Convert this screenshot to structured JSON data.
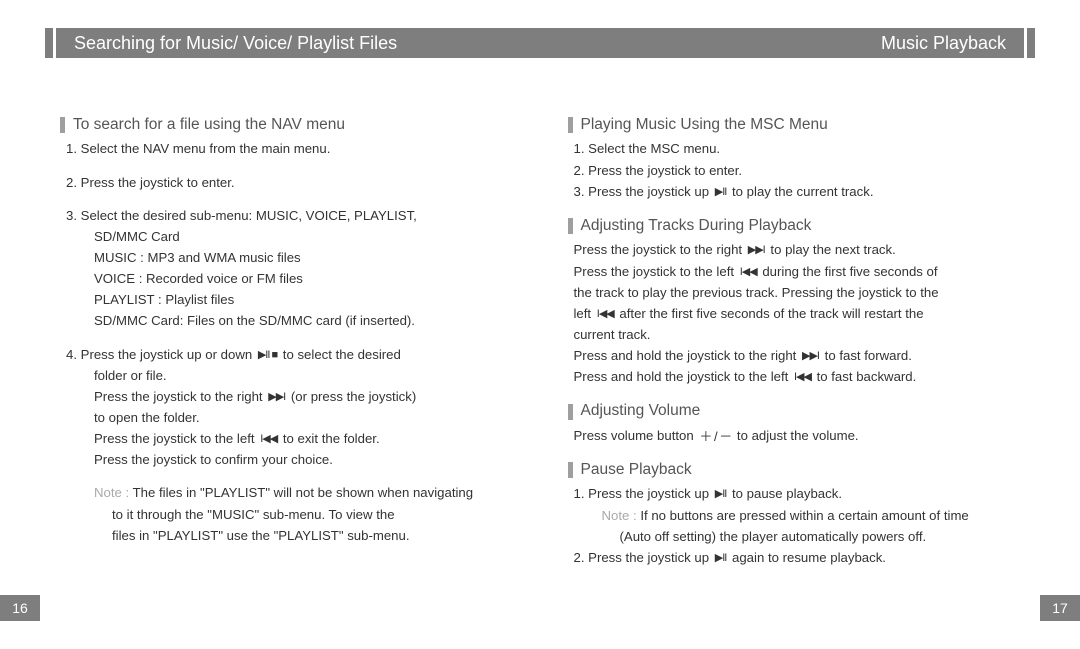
{
  "header": {
    "left": "Searching for Music/ Voice/ Playlist Files",
    "right": "Music Playback"
  },
  "footer": {
    "left": "16",
    "right": "17"
  },
  "left": {
    "h1": "To search for a file using the NAV menu",
    "l1": "1. Select the NAV  menu from the main menu.",
    "l2": "2. Press the joystick to enter.",
    "l3": "3. Select the desired sub-menu: MUSIC, VOICE, PLAYLIST,",
    "l3b": "SD/MMC Card",
    "l3c": "MUSIC : MP3 and WMA music files",
    "l3d": "VOICE : Recorded voice or FM files",
    "l3e": "PLAYLIST : Playlist files",
    "l3f": "SD/MMC Card: Files on the SD/MMC card (if inserted).",
    "l4a": "4. Press the joystick up or down    ",
    "l4b": " to select the desired",
    "l4c": "folder or file.",
    "l5a": "Press the joystick to the right   ",
    "l5b": " (or press the joystick)",
    "l5c": "to open the folder.",
    "l6a": "Press the joystick to the left   ",
    "l6b": " to exit the folder.",
    "l7": "Press the joystick to confirm your choice.",
    "noteLabel": "Note :",
    "n1": "  The files in \"PLAYLIST\" will not be shown when navigating",
    "n2": "to it through the \"MUSIC\" sub-menu.  To view the",
    "n3": "files in \"PLAYLIST\" use the \"PLAYLIST\" sub-menu."
  },
  "right": {
    "h1": "Playing Music Using the MSC Menu",
    "p1a": "1. Select the MSC menu.",
    "p1b": "2. Press the joystick to enter.",
    "p1c1": "3. Press the joystick up  ",
    "p1c2": " to play the current track.",
    "h2": "Adjusting Tracks During Playback",
    "p2a1": "Press the joystick to the right    ",
    "p2a2": " to play the next track.",
    "p2b1": "Press the joystick to the left     ",
    "p2b2": " during the first five seconds of",
    "p2c": "the track to play the previous track.  Pressing the joystick to the",
    "p2d1": "left   ",
    "p2d2": "  after the first five seconds of the track will restart the",
    "p2e": "current track.",
    "p2f1": "Press and hold the joystick to the right     ",
    "p2f2": " to fast forward.",
    "p2g1": "Press and hold the joystick to the left     ",
    "p2g2": " to fast backward.",
    "h3": "Adjusting Volume",
    "p3a1": "Press volume button   ",
    "p3a2": " to adjust the volume.",
    "h4": "Pause Playback",
    "p4a1": "1. Press the joystick up  ",
    "p4a2": " to pause playback.",
    "noteLabel": "Note :",
    "p4b": " If no buttons are pressed within a certain amount of time",
    "p4c": "(Auto off setting) the player automatically powers off.",
    "p4d1": "2. Press the joystick up  ",
    "p4d2": " again to resume playback."
  },
  "icons": {
    "playpause": "▶II",
    "upplaypause": "▶II ■",
    "next": "▶▶I",
    "prev": "I◀◀",
    "volume": "＋ / －"
  }
}
